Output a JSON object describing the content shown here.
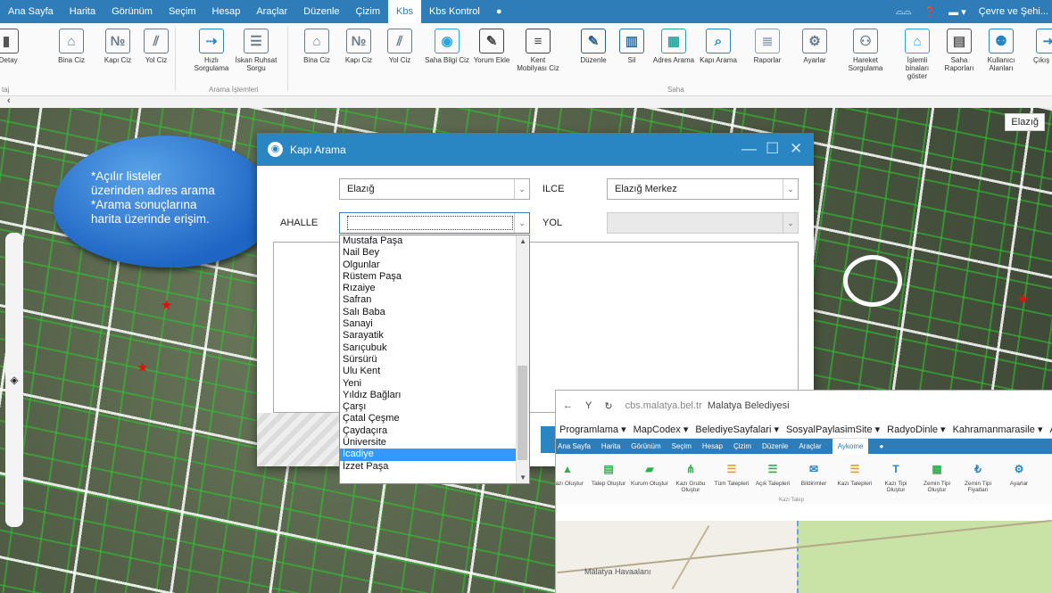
{
  "menu": {
    "items": [
      "Ana Sayfa",
      "Harita",
      "Görünüm",
      "Seçim",
      "Hesap",
      "Araçlar",
      "Düzenle",
      "Çizim",
      "Kbs",
      "Kbs Kontrol"
    ],
    "active_index": 8,
    "user": "Çevre ve Şehi..."
  },
  "ribbon": {
    "buttons": [
      {
        "label": "ı Detay",
        "icon": "building-info-icon",
        "color": "#555555"
      },
      {
        "label": "Bina Ciz",
        "icon": "house-icon",
        "color": "#6a7b8a"
      },
      {
        "label": "Kapı Ciz",
        "icon": "door-number-icon",
        "color": "#6a7b8a"
      },
      {
        "label": "Yol Ciz",
        "icon": "road-icon",
        "color": "#6a7b8a"
      },
      {
        "label": "Hızlı Sorgulama",
        "icon": "quick-query-icon",
        "color": "#2a85c3"
      },
      {
        "label": "İskan Ruhsat Sorgu",
        "icon": "document-icon",
        "color": "#6a7b8a"
      },
      {
        "label": "Bina Ciz",
        "icon": "house-icon",
        "color": "#6a7b8a"
      },
      {
        "label": "Kapı Ciz",
        "icon": "door-number-icon",
        "color": "#6a7b8a"
      },
      {
        "label": "Yol Ciz",
        "icon": "road-icon",
        "color": "#6a7b8a"
      },
      {
        "label": "Saha Bilgi Ciz",
        "icon": "field-info-icon",
        "color": "#2aa6d8"
      },
      {
        "label": "Yorum Ekle",
        "icon": "comment-icon",
        "color": "#444444"
      },
      {
        "label": "Kent Mobilyası Ciz",
        "icon": "bench-icon",
        "color": "#444444"
      },
      {
        "label": "Düzenle",
        "icon": "pencil-icon",
        "color": "#2a5f8a"
      },
      {
        "label": "Sil",
        "icon": "trash-icon",
        "color": "#2a6fa8"
      },
      {
        "label": "Adres Arama",
        "icon": "address-map-icon",
        "color": "#2aa6a0"
      },
      {
        "label": "Kapı Arama",
        "icon": "door-search-icon",
        "color": "#2a85c3"
      },
      {
        "label": "Raporlar",
        "icon": "report-icon",
        "color": "#8aa0b8"
      },
      {
        "label": "Ayarlar",
        "icon": "gear-icon",
        "color": "#6a7b8a"
      },
      {
        "label": "Hareket Sorgulama",
        "icon": "people-icon",
        "color": "#6a7b8a"
      },
      {
        "label": "İşlemli binaları göster",
        "icon": "house-check-icon",
        "color": "#2aa6d8"
      },
      {
        "label": "Saha Raporları",
        "icon": "field-report-icon",
        "color": "#555555"
      },
      {
        "label": "Kullanıcı Alanları",
        "icon": "user-area-icon",
        "color": "#2a85c3"
      },
      {
        "label": "Çıkış Yap",
        "icon": "logout-icon",
        "color": "#2a85c3"
      }
    ],
    "group_labels": [
      "taj",
      "Arama İşlemleri",
      "Saha"
    ]
  },
  "map": {
    "label": "Elazığ"
  },
  "callout": {
    "lines": [
      "*Açılır listeler",
      "üzerinden adres arama",
      "*Arama sonuçlarına",
      "harita üzerinde erişim."
    ]
  },
  "dialog": {
    "title": "Kapı Arama",
    "il_label": "",
    "il_value": "Elazığ",
    "ilce_label": "ILCE",
    "ilce_value": "Elazığ Merkez",
    "mahalle_label": "AHALLE",
    "yol_label": "YOL",
    "mahalle_options": [
      "Mustafa Paşa",
      "Nail Bey",
      "Olgunlar",
      "Rüstem Paşa",
      "Rızaiye",
      "Safran",
      "Salı Baba",
      "Sanayi",
      "Sarayatik",
      "Sarıçubuk",
      "Sürsürü",
      "Ulu Kent",
      "Yeni",
      "Yıldız Bağları",
      "Çarşı",
      "Çatal Çeşme",
      "Çaydaçıra",
      "Üniversite",
      "İcadiye",
      "İzzet Paşa"
    ],
    "selected_option": "İcadiye"
  },
  "browser": {
    "url": "cbs.malatya.bel.tr",
    "page_title": "Malatya Belediyesi",
    "favorites": [
      "Programlama ▾",
      "MapCodex ▾",
      "BelediyeSayfalari ▾",
      "SosyalPaylasimSite ▾",
      "RadyoDinle ▾",
      "Kahramanmarasile ▾",
      "Asmalı Ko"
    ],
    "menu_items": [
      "Ana Sayfa",
      "Harita",
      "Görünüm",
      "Seçim",
      "Hesap",
      "Çizim",
      "Düzenle",
      "Araçlar",
      "Aykome"
    ],
    "menu_active": "Aykome",
    "ribbon_buttons": [
      {
        "label": "Kazı Oluştur",
        "icon": "dig-icon",
        "color": "#2fae4e"
      },
      {
        "label": "Talep Oluştur",
        "icon": "request-icon",
        "color": "#2fae4e"
      },
      {
        "label": "Kurum Oluştur",
        "icon": "institution-icon",
        "color": "#2fae4e"
      },
      {
        "label": "Kazı Grubu Oluştur",
        "icon": "group-icon",
        "color": "#2fae4e"
      },
      {
        "label": "Tüm Talepleri",
        "icon": "list-icon",
        "color": "#e0a020"
      },
      {
        "label": "Açık Talepleri",
        "icon": "open-list-icon",
        "color": "#2fae4e"
      },
      {
        "label": "Bildirimler",
        "icon": "notify-icon",
        "color": "#2a85c3"
      },
      {
        "label": "Kazı Talepleri",
        "icon": "dig-list-icon",
        "color": "#e0a020"
      },
      {
        "label": "Kazı Tipi Oluştur",
        "icon": "type-icon",
        "color": "#2a85c3"
      },
      {
        "label": "Zemin Tipi Oluştur",
        "icon": "ground-icon",
        "color": "#2fae4e"
      },
      {
        "label": "Zemin Tipi Fiyatları",
        "icon": "lira-icon",
        "color": "#2a85c3"
      },
      {
        "label": "Ayarlar",
        "icon": "gear-icon",
        "color": "#2a85c3"
      }
    ],
    "group_label": "Kazı Talep",
    "map_label": "Malatya Havaalanı"
  },
  "colors": {
    "accent": "#2e7db8",
    "dialog_title": "#2a85c3",
    "selected": "#3399ff"
  }
}
